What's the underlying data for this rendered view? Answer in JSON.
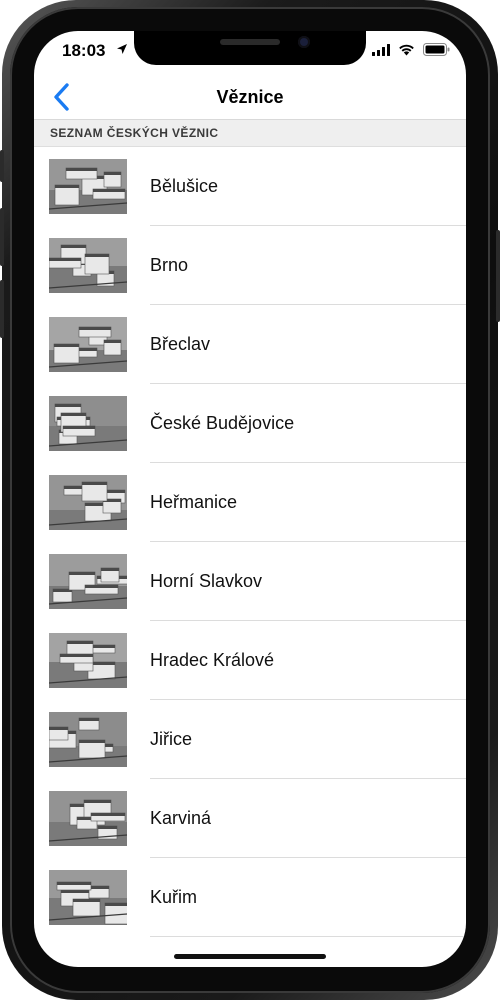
{
  "status_bar": {
    "time": "18:03"
  },
  "nav": {
    "title": "Věznice"
  },
  "section": {
    "header": "SEZNAM ČESKÝCH VĚZNIC"
  },
  "prisons": [
    {
      "name": "Bělušice"
    },
    {
      "name": "Brno"
    },
    {
      "name": "Břeclav"
    },
    {
      "name": "České Budějovice"
    },
    {
      "name": "Heřmanice"
    },
    {
      "name": "Horní Slavkov"
    },
    {
      "name": "Hradec Králové"
    },
    {
      "name": "Jiřice"
    },
    {
      "name": "Karviná"
    },
    {
      "name": "Kuřim"
    }
  ],
  "colors": {
    "accent": "#1a7bf2",
    "section_bg": "#efefef",
    "separator": "#dcdcdc"
  },
  "icons": [
    "back-chevron-icon",
    "location-arrow-icon",
    "signal-icon",
    "wifi-icon",
    "battery-icon"
  ]
}
